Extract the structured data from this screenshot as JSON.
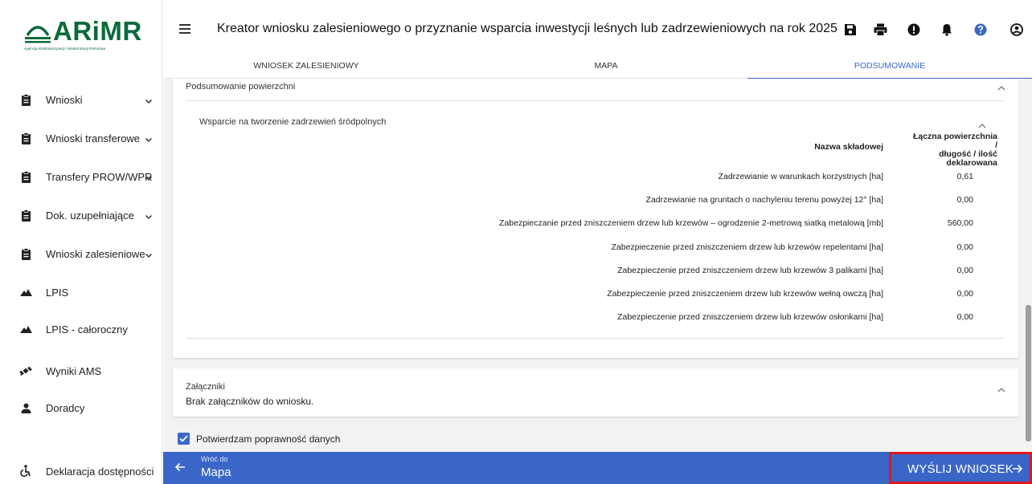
{
  "logo": {
    "name": "ARiMR",
    "subtitle": "Agencja Restrukturyzacji i Modernizacji Rolnictwa"
  },
  "sidebar": {
    "items": [
      {
        "label": "Wnioski",
        "icon": "clipboard-icon",
        "expandable": true
      },
      {
        "label": "Wnioski transferowe",
        "icon": "clipboard-icon",
        "expandable": true
      },
      {
        "label": "Transfery PROW/WPR",
        "icon": "clipboard-icon",
        "expandable": true
      },
      {
        "label": "Dok. uzupełniające",
        "icon": "clipboard-icon",
        "expandable": true
      },
      {
        "label": "Wnioski zalesieniowe",
        "icon": "clipboard-icon",
        "expandable": true
      },
      {
        "label": "LPIS",
        "icon": "mountain-icon",
        "expandable": false
      },
      {
        "label": "LPIS - całoroczny",
        "icon": "mountain-icon",
        "expandable": false
      },
      {
        "label": "Wyniki AMS",
        "icon": "satellite-icon",
        "expandable": false
      },
      {
        "label": "Doradcy",
        "icon": "person-icon",
        "expandable": false
      },
      {
        "label": "Deklaracja dostępności",
        "icon": "accessibility-icon",
        "expandable": false
      }
    ]
  },
  "header": {
    "title": "Kreator wniosku zalesieniowego o przyznanie wsparcia inwestycji leśnych lub zadrzewieniowych na rok 2025",
    "icons": [
      "save-icon",
      "print-icon",
      "alert-icon",
      "bell-icon",
      "help-icon",
      "account-icon"
    ]
  },
  "tabs": [
    {
      "label": "WNIOSEK ZALESIENIOWY",
      "active": false
    },
    {
      "label": "MAPA",
      "active": false
    },
    {
      "label": "PODSUMOWANIE",
      "active": true
    }
  ],
  "summary": {
    "title": "Podsumowanie powierzchni",
    "section_title": "Wsparcie na tworzenie zadrzewień śródpolnych",
    "col_name": "Nazwa składowej",
    "col_value_lines": [
      "Łączna powierzchnia /",
      "długość / ilość",
      "deklarowana"
    ],
    "rows": [
      {
        "name": "Zadrzewianie w warunkach korzystnych [ha]",
        "value": "0,61"
      },
      {
        "name": "Zadrzewianie na gruntach o nachyleniu terenu powyżej 12° [ha]",
        "value": "0,00"
      },
      {
        "name": "Zabezpieczanie przed zniszczeniem drzew lub krzewów – ogrodzenie 2-metrową siatką metalową [mb]",
        "value": "560,00"
      },
      {
        "name": "Zabezpieczenie przed zniszczeniem drzew lub krzewów repelentami [ha]",
        "value": "0,00"
      },
      {
        "name": "Zabezpieczenie przed zniszczeniem drzew lub krzewów 3 palikami [ha]",
        "value": "0,00"
      },
      {
        "name": "Zabezpieczenie przed zniszczeniem drzew lub krzewów wełną owczą [ha]",
        "value": "0,00"
      },
      {
        "name": "Zabezpieczenie przed zniszczeniem drzew lub krzewów osłonkami [ha]",
        "value": "0,00"
      }
    ]
  },
  "attachments": {
    "title": "Załączniki",
    "text": "Brak załączników do wniosku."
  },
  "confirm": {
    "label": "Potwierdzam poprawność danych",
    "checked": true
  },
  "footer": {
    "back_small": "Wróć do",
    "back_big": "Mapa",
    "send_label": "WYŚLIJ WNIOSEK"
  },
  "colors": {
    "accent": "#3a67c7",
    "brand": "#0a6b3a",
    "highlight": "#e0161a"
  }
}
